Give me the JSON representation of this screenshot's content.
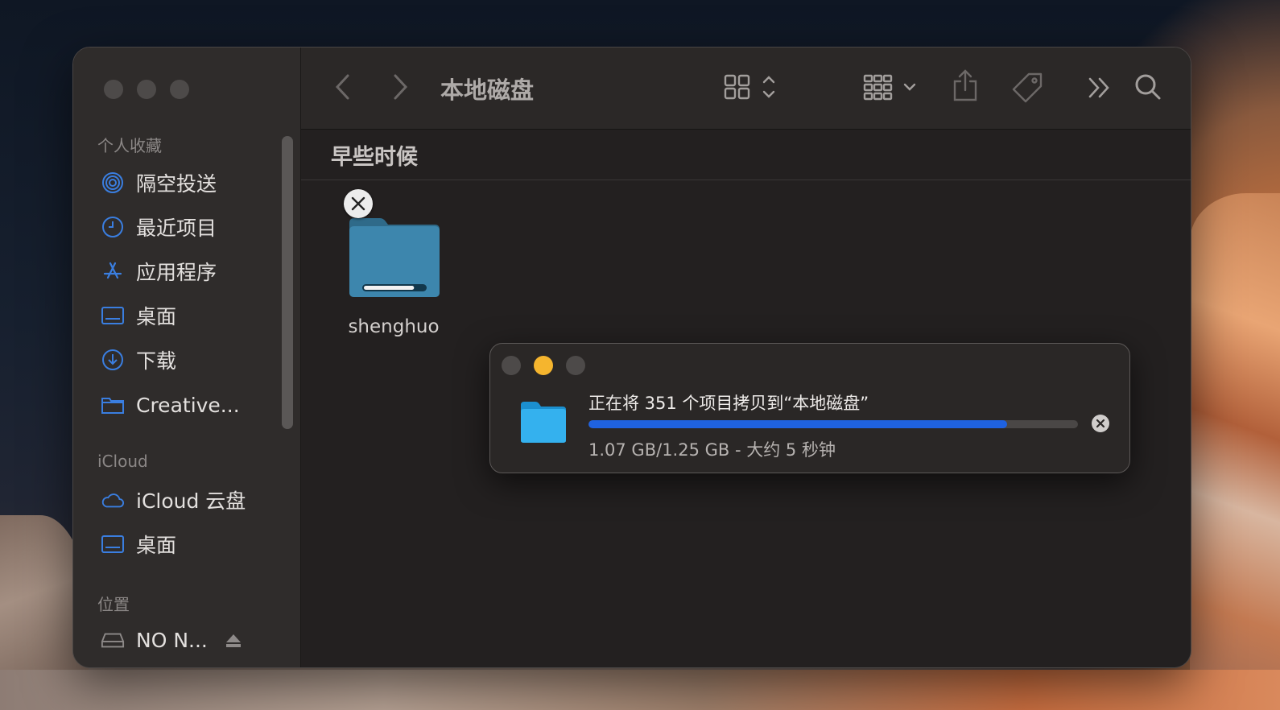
{
  "toolbar": {
    "title": "本地磁盘"
  },
  "sidebar": {
    "favorites_label": "个人收藏",
    "favorites": [
      {
        "label": "隔空投送",
        "icon": "airdrop-icon"
      },
      {
        "label": "最近项目",
        "icon": "clock-icon"
      },
      {
        "label": "应用程序",
        "icon": "applications-icon"
      },
      {
        "label": "桌面",
        "icon": "desktop-icon"
      },
      {
        "label": "下载",
        "icon": "download-icon"
      },
      {
        "label": "Creative...",
        "icon": "folder-icon"
      }
    ],
    "icloud_label": "iCloud",
    "icloud": [
      {
        "label": "iCloud 云盘",
        "icon": "cloud-icon"
      },
      {
        "label": "桌面",
        "icon": "desktop-icon"
      }
    ],
    "locations_label": "位置",
    "locations": [
      {
        "label": "NO N...",
        "icon": "drive-icon"
      }
    ]
  },
  "content": {
    "group_header": "早些时候",
    "file": {
      "name": "shenghuo",
      "progress": 0.82
    }
  },
  "copy_dialog": {
    "title": "正在将 351 个项目拷贝到“本地磁盘”",
    "status": "1.07 GB/1.25 GB - 大约 5 秒钟",
    "progress": 0.856
  },
  "colors": {
    "accent": "#1f62e0",
    "minimize": "#f5b52e",
    "sidebar_icon": "#3a7ee0"
  }
}
